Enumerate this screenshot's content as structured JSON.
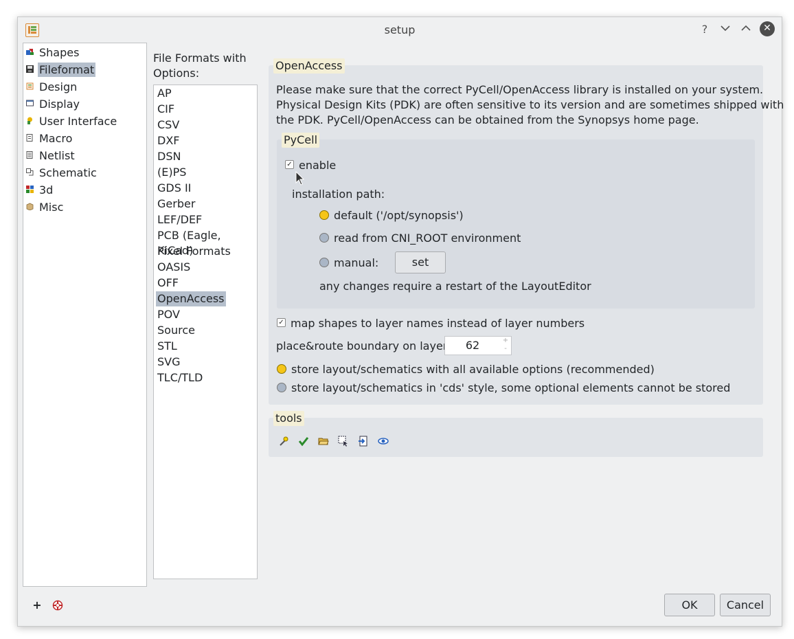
{
  "window": {
    "title": "setup",
    "help_glyph": "?",
    "minimize_glyph": "⌄",
    "maximize_glyph": "⌃",
    "close_glyph": "✕"
  },
  "nav": {
    "items": [
      {
        "label": "Shapes",
        "icon": "shapes-icon",
        "selected": false
      },
      {
        "label": "Fileformat",
        "icon": "floppy-disk-icon",
        "selected": true
      },
      {
        "label": "Design",
        "icon": "design-icon",
        "selected": false
      },
      {
        "label": "Display",
        "icon": "display-icon",
        "selected": false
      },
      {
        "label": "User Interface",
        "icon": "user-interface-icon",
        "selected": false
      },
      {
        "label": "Macro",
        "icon": "macro-icon",
        "selected": false
      },
      {
        "label": "Netlist",
        "icon": "netlist-icon",
        "selected": false
      },
      {
        "label": "Schematic",
        "icon": "schematic-icon",
        "selected": false
      },
      {
        "label": "3d",
        "icon": "3d-icon",
        "selected": false
      },
      {
        "label": "Misc",
        "icon": "misc-box-icon",
        "selected": false
      }
    ]
  },
  "formats": {
    "heading": "File Formats with Options:",
    "items": [
      "AP",
      "CIF",
      "CSV",
      "DXF",
      "DSN",
      "(E)PS",
      "GDS II",
      "Gerber",
      "LEF/DEF",
      "PCB (Eagle, KiCad)",
      "Pixel Formats",
      "OASIS",
      "OFF",
      "OpenAccess",
      "POV",
      "Source",
      "STL",
      "SVG",
      "TLC/TLD"
    ],
    "selected": "OpenAccess"
  },
  "openaccess": {
    "group_title": "OpenAccess",
    "info": [
      "Please make sure that the correct PyCell/OpenAccess library is installed on your system.",
      "Physical Design Kits (PDK) are often sensitive to its version and are sometimes shipped with",
      "the PDK. PyCell/OpenAccess can be obtained from the Synopsys home page."
    ],
    "pycell": {
      "group_title": "PyCell",
      "enable_label": "enable",
      "enable_checked": true,
      "install_path_label": "installation path:",
      "radio_default": "default ('/opt/synopsis')",
      "radio_env": "read from CNI_ROOT environment",
      "radio_manual": "manual:",
      "selected_path_option": "default",
      "set_button": "set",
      "restart_note": "any changes require a restart of the LayoutEditor"
    },
    "map_shapes_label": "map shapes to layer names instead of layer numbers",
    "map_shapes_checked": true,
    "boundary_label": "place&route boundary on  layer",
    "boundary_layer": "62",
    "spin_up": "+",
    "spin_down": "-",
    "store_all_label": "store layout/schematics with all available options (recommended)",
    "store_cds_label": "store layout/schematics in 'cds' style, some optional elements cannot be stored",
    "store_selected": "all"
  },
  "tools": {
    "group_title": "tools",
    "icons": [
      "wand-icon",
      "checkmark-icon",
      "open-folder-icon",
      "cell-select-icon",
      "import-icon",
      "eye-icon"
    ]
  },
  "footer": {
    "add_glyph": "+",
    "ok_label": "OK",
    "cancel_label": "Cancel"
  }
}
